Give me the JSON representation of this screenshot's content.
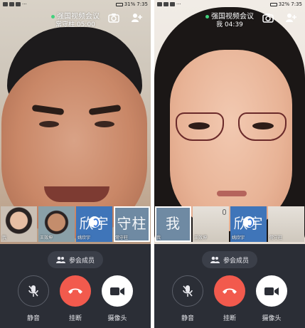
{
  "left": {
    "status": {
      "carrier": "",
      "battery": "31%",
      "time": "7:35"
    },
    "title": "强国视频会议",
    "subtitle": "常守柱 05:00",
    "thumbnails": [
      {
        "name": "我",
        "avatar_text": ""
      },
      {
        "name": "王效坤",
        "avatar_text": ""
      },
      {
        "name": "姚欣宇",
        "avatar_text": "欣宇"
      },
      {
        "name": "常守柱",
        "avatar_text": "守柱"
      }
    ],
    "members_label": "参会成员",
    "buttons": {
      "mute": "静音",
      "hangup": "挂断",
      "camera": "摄像头"
    }
  },
  "right": {
    "status": {
      "carrier": "",
      "battery": "32%",
      "time": "7:35"
    },
    "title": "强国视频会议",
    "subtitle": "我 04:39",
    "thumbnails": [
      {
        "name": "我",
        "avatar_text": "我"
      },
      {
        "name": "王效坤",
        "avatar_text": ""
      },
      {
        "name": "姚欣宇",
        "avatar_text": "欣宇"
      },
      {
        "name": "常守柱",
        "avatar_text": ""
      }
    ],
    "members_label": "参会成员",
    "buttons": {
      "mute": "静音",
      "hangup": "挂断",
      "camera": "摄像头"
    }
  },
  "colors": {
    "hangup": "#f25a4d",
    "controls_bg": "#2b2e36",
    "active_dot": "#41d17d"
  },
  "icons": [
    "camera-switch-icon",
    "add-user-icon",
    "group-icon",
    "mic-off-icon",
    "phone-hangup-icon",
    "video-camera-icon"
  ]
}
